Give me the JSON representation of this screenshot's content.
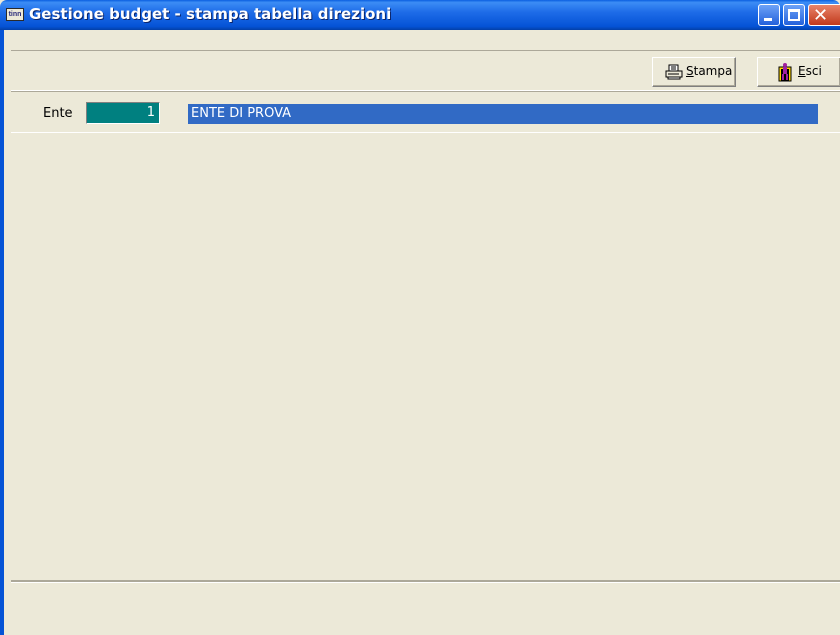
{
  "window": {
    "title": "Gestione budget - stampa tabella direzioni",
    "app_icon_text": "tinn",
    "controls": {
      "minimize_icon": "minimize-icon",
      "maximize_icon": "maximize-icon",
      "close_icon": "close-icon"
    }
  },
  "toolbar": {
    "stampa_label_underlined": "S",
    "stampa_label_rest": "tampa",
    "esci_label_underlined": "E",
    "esci_label_rest": "sci",
    "stampa_icon": "printer-icon",
    "esci_icon": "exit-door-icon"
  },
  "ente": {
    "label": "Ente",
    "code": "1",
    "name": "ENTE DI PROVA",
    "code_bg_color": "#008080",
    "name_bg_color": "#316AC5"
  },
  "status": {}
}
